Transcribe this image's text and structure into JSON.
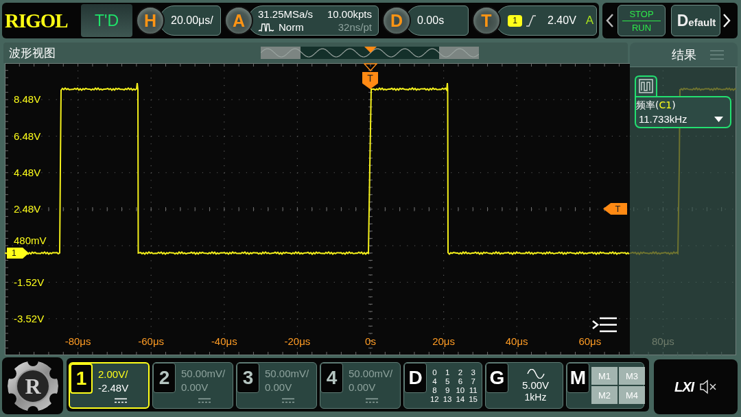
{
  "top_bar": {
    "brand": "RIGOL",
    "mode_button": "T'D",
    "horizontal": {
      "key": "H",
      "value": "20.00μs/"
    },
    "acquisition": {
      "key": "A",
      "sample_rate": "31.25MSa/s",
      "memory_depth": "10.00kpts",
      "mode": "Norm",
      "sample_interval": "32ns/pt"
    },
    "delay": {
      "key": "D",
      "value": "0.00s"
    },
    "trigger": {
      "key": "T",
      "source": "1",
      "level": "2.40V",
      "sweep": "A"
    },
    "run_control": {
      "stop": "STOP",
      "run": "RUN"
    },
    "default_button": "Default"
  },
  "waveform_view": {
    "title": "波形视图",
    "y_labels": [
      "8.48V",
      "6.48V",
      "4.48V",
      "2.48V",
      "480mV",
      "-1.52V",
      "-3.52V"
    ],
    "x_labels": [
      "-80μs",
      "-60μs",
      "-40μs",
      "-20μs",
      "0s",
      "20μs",
      "40μs",
      "60μs",
      "80μs"
    ],
    "channel_marker": "1",
    "trigger_marker": "T",
    "trigger_level_marker": "T"
  },
  "results": {
    "title": "结果",
    "measurements": [
      {
        "label": [
          {
            "text": "频率(",
            "highlight": false
          },
          {
            "text": "C1",
            "highlight": true
          },
          {
            "text": ")",
            "highlight": false
          }
        ],
        "value": "11.733kHz"
      }
    ]
  },
  "bottom_bar": {
    "logo_letter": "R",
    "channels": [
      {
        "number": "1",
        "scale": "2.00V/",
        "offset": "-2.48V",
        "selected": true
      },
      {
        "number": "2",
        "scale": "50.00mV/",
        "offset": "0.00V",
        "selected": false
      },
      {
        "number": "3",
        "scale": "50.00mV/",
        "offset": "0.00V",
        "selected": false
      },
      {
        "number": "4",
        "scale": "50.00mV/",
        "offset": "0.00V",
        "selected": false
      }
    ],
    "digital": {
      "key": "D",
      "bits": [
        "0",
        "1",
        "2",
        "3",
        "4",
        "5",
        "6",
        "7",
        "8",
        "9",
        "10",
        "11",
        "12",
        "13",
        "14",
        "15"
      ]
    },
    "generator": {
      "key": "G",
      "amplitude": "5.00V",
      "frequency": "1kHz"
    },
    "math": {
      "key": "M",
      "slots": [
        "M1",
        "M3",
        "M2",
        "M4"
      ]
    },
    "lxi": "LXI"
  }
}
